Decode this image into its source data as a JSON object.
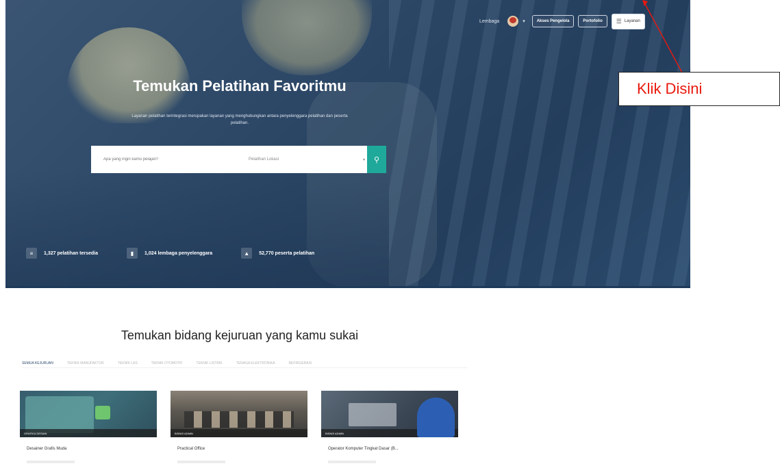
{
  "nav": {
    "link": "Lembaga",
    "admin_button": "Akses Pengelola",
    "portal_button": "Portofolio",
    "menu_button": "Layanan"
  },
  "hero": {
    "title": "Temukan Pelatihan Favoritmu",
    "subtitle": "Layanan pelatihan terintegrasi merupakan layanan yang menghubungkan antara penyelenggara pelatihan dan peserta pelatihan."
  },
  "search": {
    "placeholder": "Apa yang ingin kamu pelajari?",
    "select_value": "Pelatihan Lokasi"
  },
  "stats": [
    {
      "icon": "list-icon",
      "label": "1,327 pelatihan tersedia"
    },
    {
      "icon": "building-icon",
      "label": "1,024 lembaga penyelenggara"
    },
    {
      "icon": "graduation-cap-icon",
      "label": "52,770 peserta pelatihan"
    }
  ],
  "annotation": {
    "label": "Klik Disini",
    "color": "#e8190e"
  },
  "section": {
    "title": "Temukan bidang kejuruan yang kamu sukai",
    "tabs": [
      "Semua Kejuruan",
      "Teknik Manufaktur",
      "Teknik Las",
      "Teknik Otomotif",
      "Teknik Listrik",
      "Tenaga Elektronika",
      "Refrigerasi"
    ]
  },
  "cards": [
    {
      "tag": "Grafika Desain",
      "title": "Desainer Grafis Muda"
    },
    {
      "tag": "Bisnis Admin",
      "title": "Practical Office"
    },
    {
      "tag": "Bisnis Admin",
      "title": "Operator Komputer Tingkat Dasar (B..."
    }
  ],
  "colors": {
    "hero_bg": "#2c4766",
    "search_button": "#1fa99a",
    "active_tab": "#2c4a6a"
  }
}
